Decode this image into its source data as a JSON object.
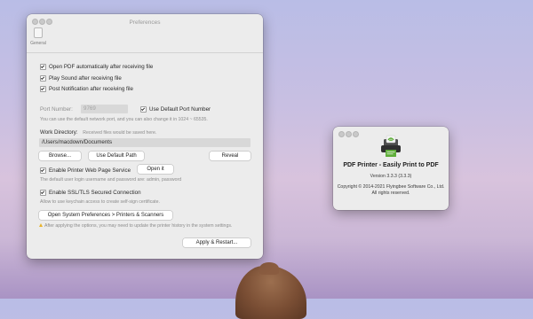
{
  "preferences_window": {
    "title": "Preferences",
    "toolbar": {
      "general_label": "General"
    },
    "checkboxes": {
      "open_pdf": "Open PDF automatically after receiving file",
      "play_sound": "Play Sound after receiving file",
      "post_notification": "Post Notification after receiving file"
    },
    "port": {
      "label": "Port Number:",
      "value": "9769",
      "use_default_label": "Use Default Port Number",
      "hint": "You can use the default network port, and you can also change it in 1024 ~ 65535."
    },
    "work_directory": {
      "label": "Work Directory:",
      "hint": "Received files would be saved here.",
      "path": "/Users/macdown/Documents",
      "browse_label": "Browse...",
      "default_path_label": "Use Default Path",
      "reveal_label": "Reveal"
    },
    "web_service": {
      "checkbox_label": "Enable Printer Web Page Service",
      "open_label": "Open it",
      "hint": "The default user login username and password are: admin, password"
    },
    "ssl": {
      "checkbox_label": "Enable SSL/TLS Secured Connection",
      "hint": "Allow to use keychain access to create self-sign certificate."
    },
    "system_prefs_label": "Open System Preferences > Printers & Scanners",
    "warning_text": "After applying the options, you may need to update the printer history in the system settings.",
    "apply_label": "Apply & Restart..."
  },
  "about_window": {
    "app_name": "PDF Printer - Easily Print to PDF",
    "version": "Version 3.3.3 (3.3.3)",
    "copyright": "Copyright © 2014-2021 Flyingbee Software Co., Ltd.",
    "rights": "All rights reserved."
  },
  "colors": {
    "window_bg": "#ececec",
    "input_bg": "#d8d8d8",
    "warning": "#e8b32a",
    "icon_green": "#5fae3a"
  },
  "icons": [
    "general-icon",
    "checkmark-icon",
    "warning-icon",
    "printer-app-icon"
  ]
}
